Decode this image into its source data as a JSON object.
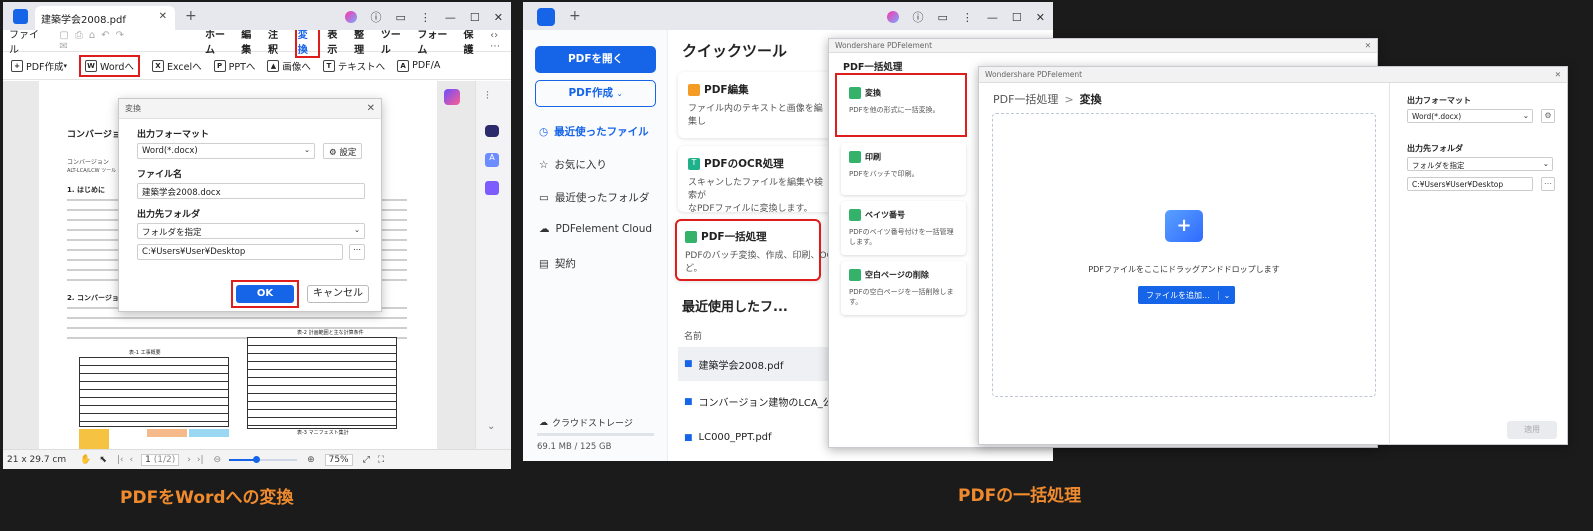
{
  "left_window": {
    "tab_title": "建築学会2008.pdf",
    "menu": [
      "ファイル",
      "ホーム",
      "編集",
      "注釈",
      "変換",
      "表示",
      "整理",
      "ツール",
      "フォーム",
      "保護"
    ],
    "toolbar": [
      "PDF作成",
      "Wordへ",
      "Excelへ",
      "PPTへ",
      "画像へ",
      "テキストへ",
      "PDF/A"
    ],
    "dialog": {
      "title": "変換",
      "format_label": "出力フォーマット",
      "format_value": "Word(*.docx)",
      "settings_label": "設定",
      "filename_label": "ファイル名",
      "filename_value": "建築学会2008.docx",
      "folder_label": "出力先フォルダ",
      "folder_select": "フォルダを指定",
      "folder_path": "C:¥Users¥User¥Desktop",
      "ok": "OK",
      "cancel": "キャンセル"
    },
    "doc": {
      "heading": "コンバージョン建",
      "sub1": "コンバージョン",
      "sub2": "ALT-LCA/LCW ツール",
      "sec1": "1. はじめに",
      "sec2": "2. コンバージョ",
      "table1_title": "表-1 工事概要",
      "table2_title": "表-2 計画範囲と主な計算条件",
      "table3_title": "表-3 マニフェスト集計"
    },
    "status": {
      "page_size": "21 x 29.7 cm",
      "page_num": "1",
      "page_total": "(1/2)",
      "zoom": "75%"
    }
  },
  "right_window": {
    "open_pdf": "PDFを開く",
    "create_pdf": "PDF作成",
    "nav": [
      "最近使ったファイル",
      "お気に入り",
      "最近使ったフォルダ",
      "PDFelement Cloud",
      "契約"
    ],
    "cloud_label": "クラウドストレージ",
    "storage": "69.1 MB / 125 GB",
    "quick_tools_title": "クイックツール",
    "cards": [
      {
        "title": "PDF編集",
        "desc": "ファイル内のテキストと画像を編集し"
      },
      {
        "title": "PDFのOCR処理",
        "desc": "スキャンしたファイルを編集や検索が"
      },
      {
        "title": "PDF一括処理",
        "desc": "PDFのバッチ変換、作成、印刷、OCR"
      }
    ],
    "card_extra": {
      "ocr_line2": "なPDFファイルに変換します。",
      "batch_line2": "ど。"
    },
    "recent_title": "最近使用したフ...",
    "col_name": "名前",
    "files": [
      "建築学会2008.pdf",
      "コンバージョン建物のLCA_公開.pdf",
      "LC000_PPT.pdf"
    ]
  },
  "batch_window": {
    "app_name": "Wondershare PDFelement",
    "title": "PDF一括処理",
    "items": [
      {
        "title": "変換",
        "desc": "PDFを他の形式に一括変換。",
        "color": "#34b26a"
      },
      {
        "title": "印刷",
        "desc": "PDFをバッチで印刷。",
        "color": "#34b26a"
      },
      {
        "title": "ベイツ番号",
        "desc": "PDFのベイツ番号付けを一括管理します。",
        "color": "#34b26a"
      },
      {
        "title": "空白ページの削除",
        "desc": "PDFの空白ページを一括削除します。",
        "color": "#34b26a"
      }
    ]
  },
  "convert_window": {
    "app_name": "Wondershare PDFelement",
    "breadcrumb_root": "PDF一括処理",
    "breadcrumb_sep": ">",
    "breadcrumb_current": "変換",
    "drop_text": "PDFファイルをここにドラッグアンドドロップします",
    "add_files": "ファイルを追加...",
    "format_label": "出力フォーマット",
    "format_value": "Word(*.docx)",
    "folder_label": "出力先フォルダ",
    "folder_select": "フォルダを指定",
    "folder_path": "C:¥Users¥User¥Desktop",
    "apply": "適用"
  },
  "captions": {
    "left": "PDFをWordへの変換",
    "right": "PDFの一括処理"
  },
  "colors": {
    "accent": "#1664e8",
    "highlight": "#e01d1d",
    "caption": "#f08a2e"
  }
}
